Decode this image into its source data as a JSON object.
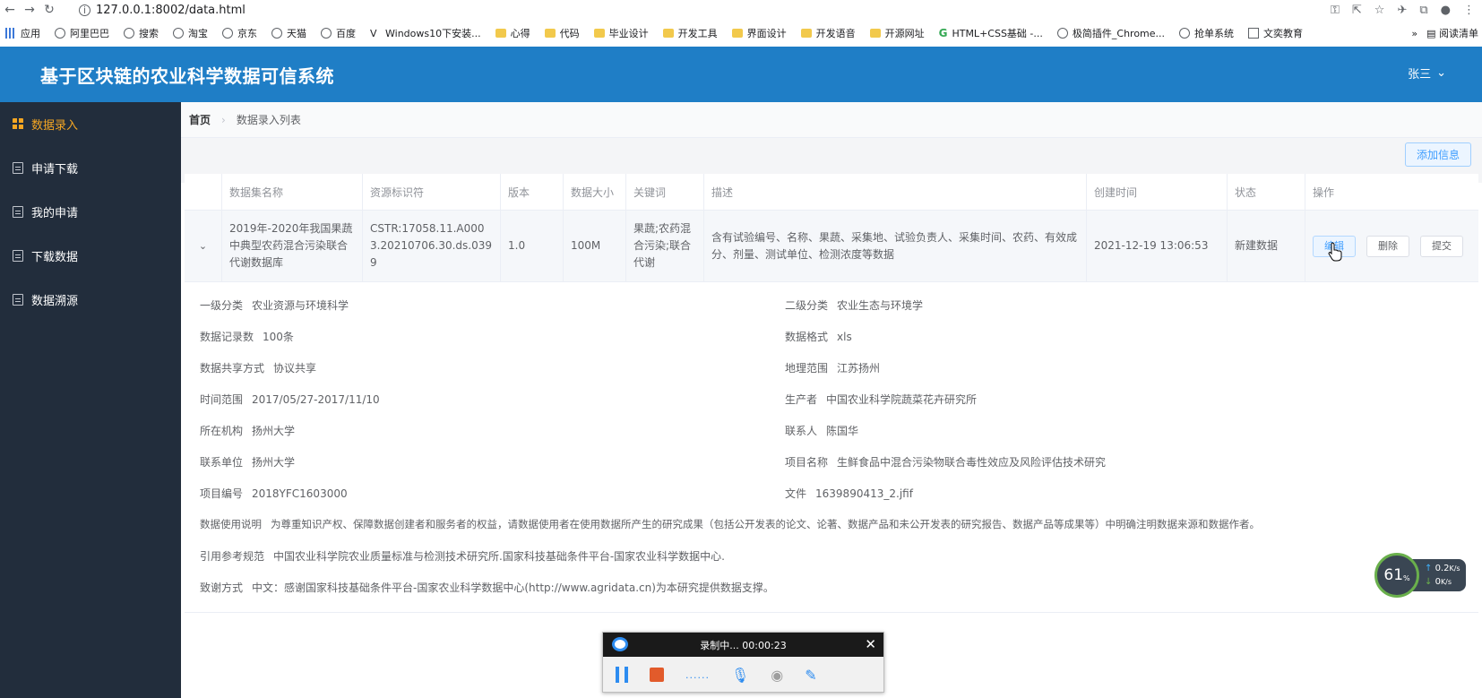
{
  "browser": {
    "url": "127.0.0.1:8002/data.html",
    "bookmarks": [
      "应用",
      "阿里巴巴",
      "搜索",
      "淘宝",
      "京东",
      "天猫",
      "百度",
      "Windows10下安装...",
      "心得",
      "代码",
      "毕业设计",
      "开发工具",
      "界面设计",
      "开发语音",
      "开源网址",
      "HTML+CSS基础 -...",
      "极简插件_Chrome...",
      "抢单系统",
      "文奕教育"
    ],
    "bookmark_more": "»",
    "reading_list": "阅读清单"
  },
  "app": {
    "title": "基于区块链的农业科学数据可信系统",
    "user": "张三"
  },
  "sidebar": {
    "items": [
      {
        "label": "数据录入",
        "active": true
      },
      {
        "label": "申请下载",
        "active": false
      },
      {
        "label": "我的申请",
        "active": false
      },
      {
        "label": "下载数据",
        "active": false
      },
      {
        "label": "数据溯源",
        "active": false
      }
    ]
  },
  "breadcrumb": {
    "home": "首页",
    "current": "数据录入列表"
  },
  "toolbar": {
    "add_label": "添加信息"
  },
  "table": {
    "headers": [
      "数据集名称",
      "资源标识符",
      "版本",
      "数据大小",
      "关键词",
      "描述",
      "创建时间",
      "状态",
      "操作"
    ],
    "rows": [
      {
        "name": "2019年-2020年我国果蔬中典型农药混合污染联合代谢数据库",
        "identifier": "CSTR:17058.11.A0003.20210706.30.ds.0399",
        "version": "1.0",
        "size": "100M",
        "keywords": "果蔬;农药混合污染;联合代谢",
        "description": "含有试验编号、名称、果蔬、采集地、试验负责人、采集时间、农药、有效成分、剂量、测试单位、检测浓度等数据",
        "created": "2021-12-19 13:06:53",
        "status": "新建数据",
        "actions": {
          "edit": "编辑",
          "delete": "删除",
          "submit": "提交"
        }
      }
    ]
  },
  "detail": {
    "level1": {
      "label": "一级分类",
      "value": "农业资源与环境科学"
    },
    "level2": {
      "label": "二级分类",
      "value": "农业生态与环境学"
    },
    "records": {
      "label": "数据记录数",
      "value": "100条"
    },
    "format": {
      "label": "数据格式",
      "value": "xls"
    },
    "share": {
      "label": "数据共享方式",
      "value": "协议共享"
    },
    "geo": {
      "label": "地理范围",
      "value": "江苏扬州"
    },
    "time": {
      "label": "时间范围",
      "value": "2017/05/27-2017/11/10"
    },
    "producer": {
      "label": "生产者",
      "value": "中国农业科学院蔬菜花卉研究所"
    },
    "org": {
      "label": "所在机构",
      "value": "扬州大学"
    },
    "contact": {
      "label": "联系人",
      "value": "陈国华"
    },
    "contact_unit": {
      "label": "联系单位",
      "value": "扬州大学"
    },
    "project_name": {
      "label": "项目名称",
      "value": "生鲜食品中混合污染物联合毒性效应及风险评估技术研究"
    },
    "project_no": {
      "label": "项目编号",
      "value": "2018YFC1603000"
    },
    "file": {
      "label": "文件",
      "value": "1639890413_2.jfif"
    },
    "usage": {
      "label": "数据使用说明",
      "value": "为尊重知识产权、保障数据创建者和服务者的权益，请数据使用者在使用数据所产生的研究成果（包括公开发表的论文、论著、数据产品和未公开发表的研究报告、数据产品等成果等）中明确注明数据来源和数据作者。"
    },
    "citation": {
      "label": "引用参考规范",
      "value": "中国农业科学院农业质量标准与检测技术研究所.国家科技基础条件平台-国家农业科学数据中心."
    },
    "thanks": {
      "label": "致谢方式",
      "value": "中文：感谢国家科技基础条件平台-国家农业科学数据中心(http://www.agridata.cn)为本研究提供数据支撑。"
    }
  },
  "recorder": {
    "status": "录制中... 00:00:23",
    "dots": "......"
  },
  "network": {
    "percent": "61",
    "percent_unit": "%",
    "up": "0.2",
    "down": "0",
    "unit": "K/s"
  }
}
